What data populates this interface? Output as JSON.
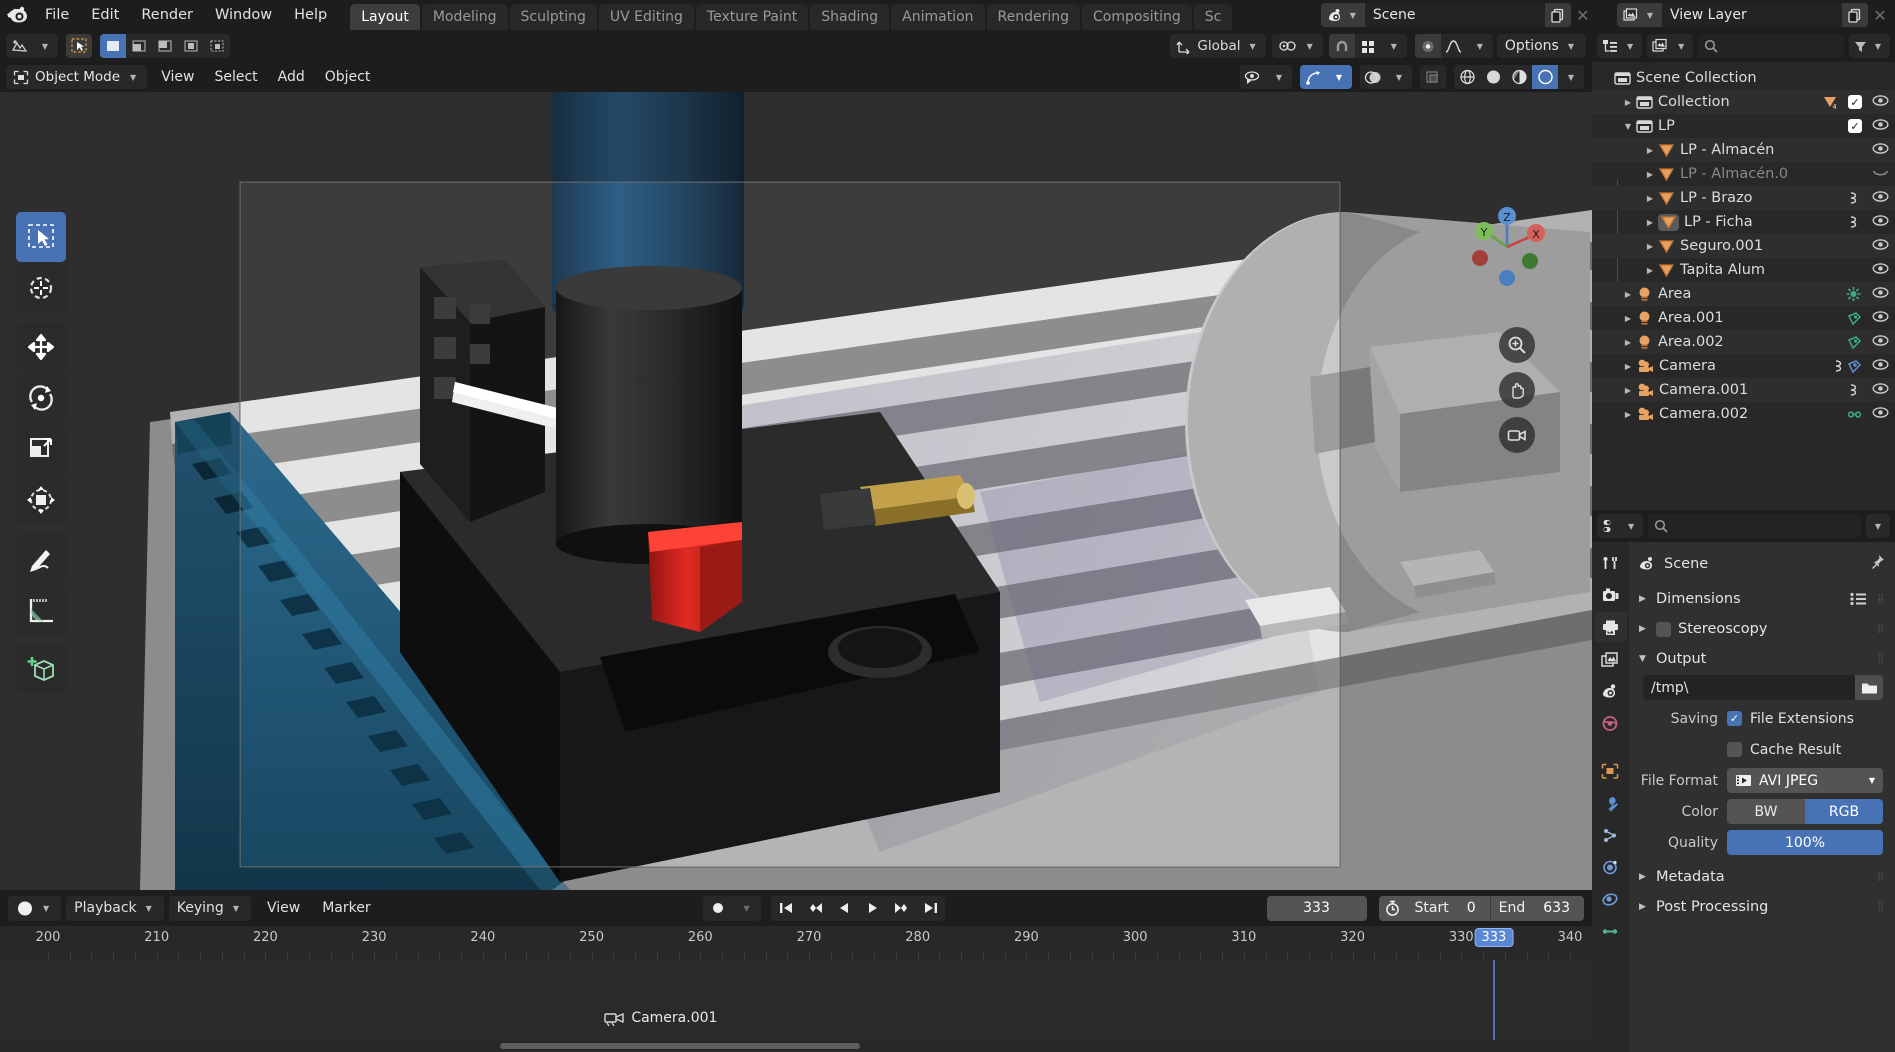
{
  "topbar": {
    "menus": [
      "File",
      "Edit",
      "Render",
      "Window",
      "Help"
    ],
    "workspaces": [
      "Layout",
      "Modeling",
      "Sculpting",
      "UV Editing",
      "Texture Paint",
      "Shading",
      "Animation",
      "Rendering",
      "Compositing",
      "Sc"
    ],
    "active_workspace": "Layout",
    "scene_name": "Scene",
    "viewlayer_name": "View Layer"
  },
  "viewport": {
    "mode": "Object Mode",
    "menus": [
      "View",
      "Select",
      "Add",
      "Object"
    ],
    "transform_orientation": "Global",
    "options_label": "Options",
    "tools": [
      "select-box-tool",
      "cursor-tool",
      "move-tool",
      "rotate-tool",
      "scale-tool",
      "transform-tool",
      "annotate-tool",
      "measure-tool",
      "add-cube-tool"
    ],
    "active_tool": "select-box-tool",
    "gizmo_axes": [
      "Z",
      "Y",
      "X"
    ]
  },
  "timeline": {
    "editor_label": "Timeline",
    "menus": [
      "Playback",
      "Keying",
      "View",
      "Marker"
    ],
    "current_frame": "333",
    "start_label": "Start",
    "start_value": "0",
    "end_label": "End",
    "end_value": "633",
    "ruler_ticks": [
      "200",
      "210",
      "220",
      "230",
      "240",
      "250",
      "260",
      "270",
      "280",
      "290",
      "300",
      "310",
      "320",
      "330",
      "340"
    ],
    "playhead_label": "333",
    "marker_label": "Camera.001"
  },
  "outliner": {
    "display_mode": "view-layer",
    "search_placeholder": "",
    "rows": [
      {
        "label": "Scene Collection",
        "indent": 0,
        "icon": "collection-icon",
        "disclosure": "none",
        "checkbox": false,
        "eye": "none",
        "dim": false
      },
      {
        "label": "Collection",
        "indent": 1,
        "icon": "collection-icon",
        "disclosure": "closed",
        "checkbox": true,
        "eye": "open",
        "dim": false,
        "extra": "mesh-data-icon"
      },
      {
        "label": "LP",
        "indent": 1,
        "icon": "collection-icon",
        "disclosure": "open",
        "checkbox": true,
        "eye": "open",
        "dim": false
      },
      {
        "label": "LP - Almacén",
        "indent": 2,
        "icon": "mesh-icon",
        "disclosure": "closed",
        "checkbox": false,
        "eye": "open",
        "dim": false
      },
      {
        "label": "LP - Almacén.0",
        "indent": 2,
        "icon": "mesh-icon",
        "disclosure": "closed",
        "checkbox": false,
        "eye": "closed",
        "dim": true
      },
      {
        "label": "LP - Brazo",
        "indent": 2,
        "icon": "mesh-icon",
        "disclosure": "closed",
        "checkbox": false,
        "eye": "open",
        "dim": false,
        "extra": "modifier-icon"
      },
      {
        "label": "LP - Ficha",
        "indent": 2,
        "icon": "mesh-icon",
        "disclosure": "closed",
        "checkbox": false,
        "eye": "open",
        "dim": false,
        "selected": true,
        "extra": "modifier-icon"
      },
      {
        "label": "Seguro.001",
        "indent": 2,
        "icon": "mesh-icon",
        "disclosure": "closed",
        "checkbox": false,
        "eye": "open",
        "dim": false
      },
      {
        "label": "Tapita Alum",
        "indent": 2,
        "icon": "mesh-icon",
        "disclosure": "closed",
        "checkbox": false,
        "eye": "open",
        "dim": false
      },
      {
        "label": "Area",
        "indent": 1,
        "icon": "light-icon",
        "disclosure": "closed",
        "checkbox": false,
        "eye": "open",
        "dim": false,
        "extra": "light-data-icon"
      },
      {
        "label": "Area.001",
        "indent": 1,
        "icon": "light-icon",
        "disclosure": "closed",
        "checkbox": false,
        "eye": "open",
        "dim": false,
        "extra": "light-area-icon"
      },
      {
        "label": "Area.002",
        "indent": 1,
        "icon": "light-icon",
        "disclosure": "closed",
        "checkbox": false,
        "eye": "open",
        "dim": false,
        "extra": "light-area-icon"
      },
      {
        "label": "Camera",
        "indent": 1,
        "icon": "camera-icon",
        "disclosure": "closed",
        "checkbox": false,
        "eye": "open",
        "dim": false,
        "extra": "animation-icon"
      },
      {
        "label": "Camera.001",
        "indent": 1,
        "icon": "camera-icon",
        "disclosure": "closed",
        "checkbox": false,
        "eye": "open",
        "dim": false,
        "extra": "animation-icon"
      },
      {
        "label": "Camera.002",
        "indent": 1,
        "icon": "camera-icon",
        "disclosure": "closed",
        "checkbox": false,
        "eye": "open",
        "dim": false,
        "extra": "camera-data-icon"
      }
    ]
  },
  "properties": {
    "search_placeholder": "",
    "breadcrumb": "Scene",
    "tabs": [
      "tool-tab",
      "render-tab",
      "output-tab",
      "viewlayer-tab",
      "scene-tab",
      "world-tab",
      "object-tab",
      "modifier-tab",
      "particles-tab",
      "physics-tab",
      "constraints-tab",
      "data-tab"
    ],
    "active_tab": "output-tab",
    "panels": {
      "dimensions": "Dimensions",
      "stereoscopy": "Stereoscopy",
      "output": "Output",
      "metadata": "Metadata",
      "post_processing": "Post Processing"
    },
    "output": {
      "path": "/tmp\\",
      "saving_label": "Saving",
      "file_extensions_label": "File Extensions",
      "file_extensions_checked": true,
      "cache_result_label": "Cache Result",
      "cache_result_checked": false,
      "file_format_label": "File Format",
      "file_format_value": "AVI JPEG",
      "color_label": "Color",
      "color_options": [
        "BW",
        "RGB"
      ],
      "color_selected": "RGB",
      "quality_label": "Quality",
      "quality_value": "100%"
    }
  },
  "colors": {
    "accent": "#4772b3",
    "panel_bg": "#303030",
    "header_bg": "#1d1d1d",
    "outliner_bg": "#282828",
    "text": "#d4d4d4"
  }
}
